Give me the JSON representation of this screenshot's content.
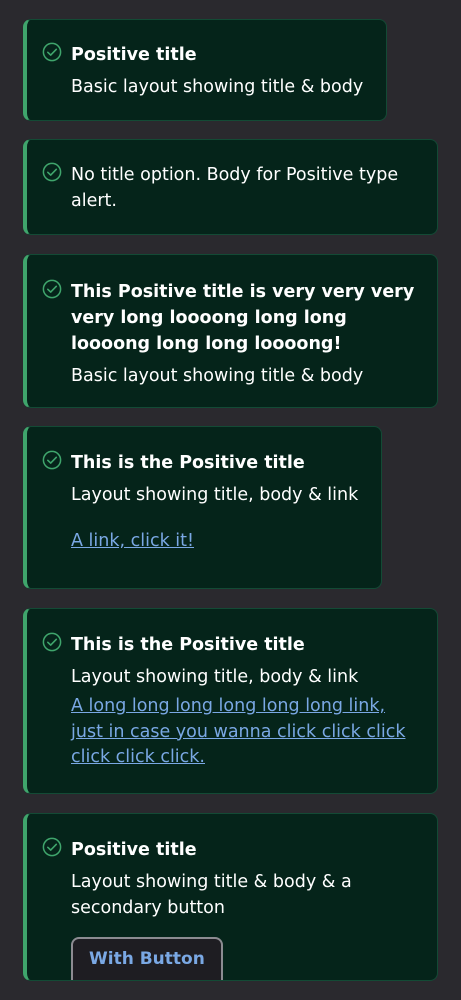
{
  "colors": {
    "page_background": "#2a292e",
    "alert_background": "#05241a",
    "alert_border": "#134a35",
    "accent_positive": "#3fa56c",
    "link": "#7aa8e4",
    "text": "#ffffff"
  },
  "alerts": [
    {
      "icon": "check-circle-icon",
      "title": "Positive title",
      "body": "Basic layout showing title & body"
    },
    {
      "icon": "check-circle-icon",
      "body": "No title option. Body for Positive type alert."
    },
    {
      "icon": "check-circle-icon",
      "title": "This Positive title is very very very very long loooong long long loooong long long loooong!",
      "body": "Basic layout showing title & body"
    },
    {
      "icon": "check-circle-icon",
      "title": "This is the Positive title",
      "body": "Layout showing title, body & link",
      "link": "A link, click it!"
    },
    {
      "icon": "check-circle-icon",
      "title": "This is the Positive title",
      "body": "Layout showing title, body & link",
      "link": "A long long long long long long link, just in case you wanna click click click click click click."
    },
    {
      "icon": "check-circle-icon",
      "title": "Positive title",
      "body": "Layout showing title & body & a secondary button",
      "button": "With Button"
    }
  ]
}
